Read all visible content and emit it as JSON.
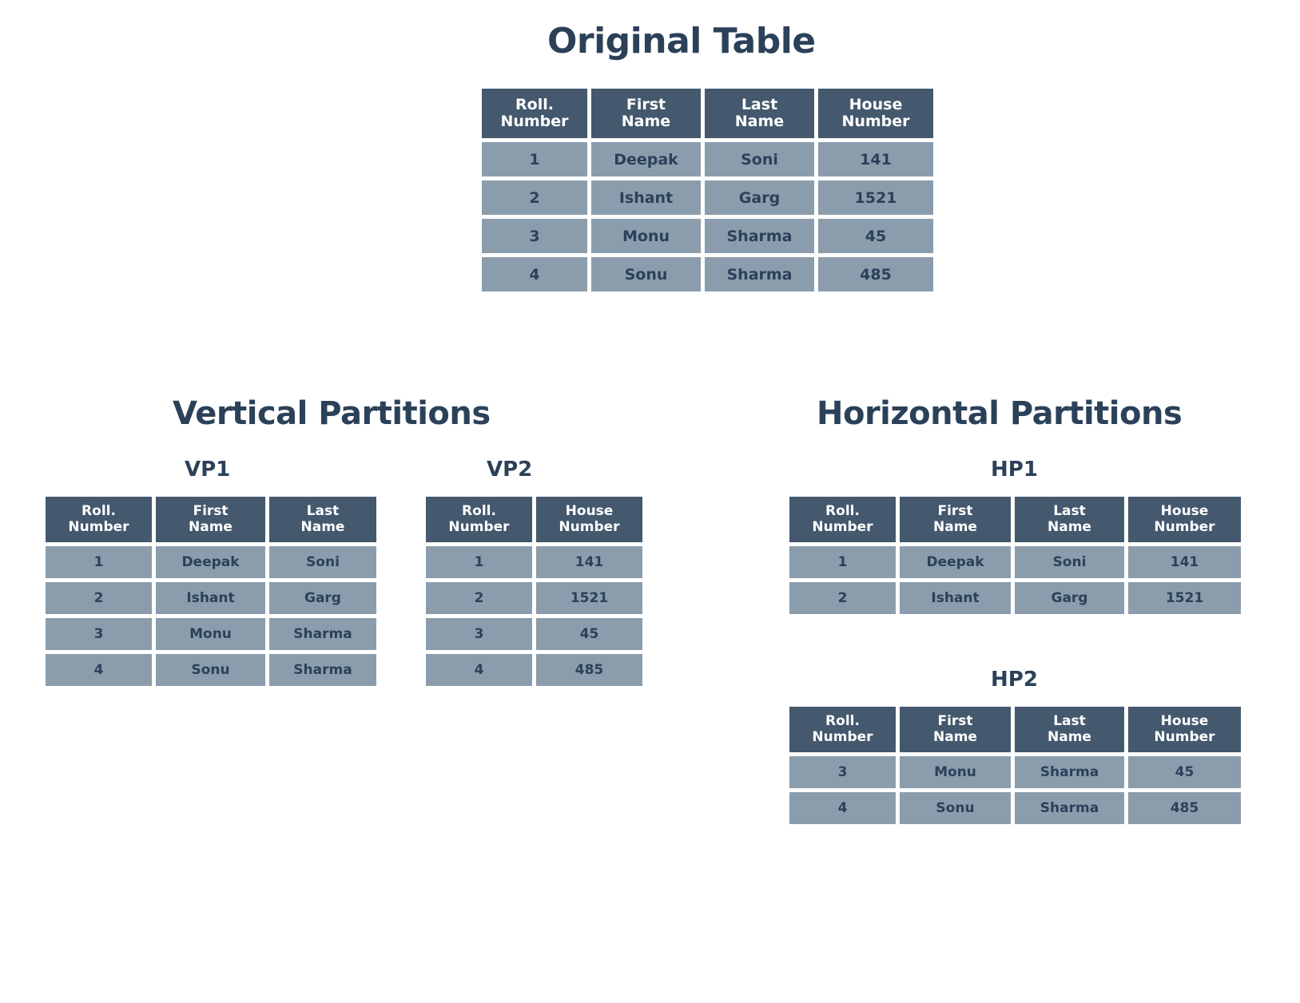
{
  "titles": {
    "original": "Original Table",
    "vertical": "Vertical Partitions",
    "horizontal": "Horizontal Partitions"
  },
  "colors": {
    "heading_text": "#2b4159",
    "table_header_bg": "#44586e",
    "table_header_text": "#ffffff",
    "table_cell_bg": "#8b9dad",
    "table_cell_text": "#2b4159",
    "page_bg": "#ffffff"
  },
  "columns": {
    "roll": {
      "line1": "Roll.",
      "line2": "Number"
    },
    "first": {
      "line1": "First",
      "line2": "Name"
    },
    "last": {
      "line1": "Last",
      "line2": "Name"
    },
    "house": {
      "line1": "House",
      "line2": "Number"
    }
  },
  "original_table": {
    "label": "Original Table",
    "headers": [
      "Roll. Number",
      "First Name",
      "Last Name",
      "House Number"
    ],
    "rows": [
      [
        "1",
        "Deepak",
        "Soni",
        "141"
      ],
      [
        "2",
        "Ishant",
        "Garg",
        "1521"
      ],
      [
        "3",
        "Monu",
        "Sharma",
        "45"
      ],
      [
        "4",
        "Sonu",
        "Sharma",
        "485"
      ]
    ]
  },
  "vertical_partitions": [
    {
      "label": "VP1",
      "headers": [
        "Roll. Number",
        "First Name",
        "Last Name"
      ],
      "rows": [
        [
          "1",
          "Deepak",
          "Soni"
        ],
        [
          "2",
          "Ishant",
          "Garg"
        ],
        [
          "3",
          "Monu",
          "Sharma"
        ],
        [
          "4",
          "Sonu",
          "Sharma"
        ]
      ]
    },
    {
      "label": "VP2",
      "headers": [
        "Roll. Number",
        "House Number"
      ],
      "rows": [
        [
          "1",
          "141"
        ],
        [
          "2",
          "1521"
        ],
        [
          "3",
          "45"
        ],
        [
          "4",
          "485"
        ]
      ]
    }
  ],
  "horizontal_partitions": [
    {
      "label": "HP1",
      "headers": [
        "Roll. Number",
        "First Name",
        "Last Name",
        "House Number"
      ],
      "rows": [
        [
          "1",
          "Deepak",
          "Soni",
          "141"
        ],
        [
          "2",
          "Ishant",
          "Garg",
          "1521"
        ]
      ]
    },
    {
      "label": "HP2",
      "headers": [
        "Roll. Number",
        "First Name",
        "Last Name",
        "House Number"
      ],
      "rows": [
        [
          "3",
          "Monu",
          "Sharma",
          "45"
        ],
        [
          "4",
          "Sonu",
          "Sharma",
          "485"
        ]
      ]
    }
  ]
}
